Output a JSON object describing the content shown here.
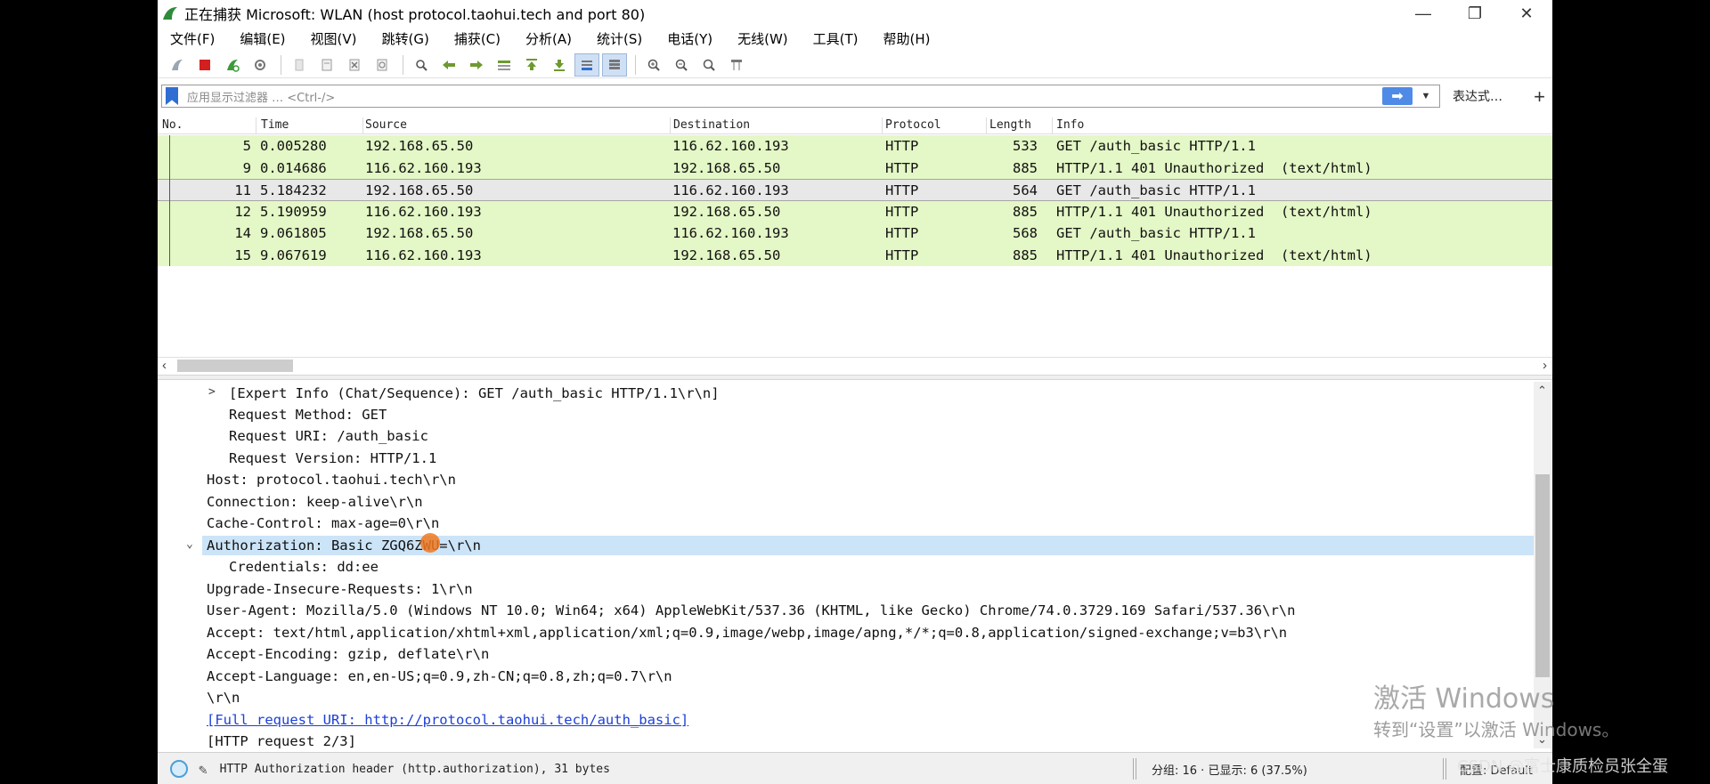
{
  "window": {
    "title": "正在捕获 Microsoft: WLAN (host protocol.taohui.tech and port 80)",
    "buttons": [
      "—",
      "❐",
      "✕"
    ]
  },
  "menu": [
    "文件(F)",
    "编辑(E)",
    "视图(V)",
    "跳转(G)",
    "捕获(C)",
    "分析(A)",
    "统计(S)",
    "电话(Y)",
    "无线(W)",
    "工具(T)",
    "帮助(H)"
  ],
  "filter": {
    "placeholder": "应用显示过滤器 … <Ctrl-/>",
    "apply_glyph": "➡",
    "dropdown_glyph": "▼",
    "expression_label": "表达式…",
    "add_glyph": "+"
  },
  "packet_list": {
    "columns": [
      "No.",
      "Time",
      "Source",
      "Destination",
      "Protocol",
      "Length",
      "Info"
    ],
    "rows": [
      {
        "no": "5",
        "time": "0.005280",
        "source": "192.168.65.50",
        "destination": "116.62.160.193",
        "protocol": "HTTP",
        "length": "533",
        "info": "GET /auth_basic HTTP/1.1"
      },
      {
        "no": "9",
        "time": "0.014686",
        "source": "116.62.160.193",
        "destination": "192.168.65.50",
        "protocol": "HTTP",
        "length": "885",
        "info": "HTTP/1.1 401 Unauthorized  (text/html)"
      },
      {
        "no": "11",
        "time": "5.184232",
        "source": "192.168.65.50",
        "destination": "116.62.160.193",
        "protocol": "HTTP",
        "length": "564",
        "info": "GET /auth_basic HTTP/1.1"
      },
      {
        "no": "12",
        "time": "5.190959",
        "source": "116.62.160.193",
        "destination": "192.168.65.50",
        "protocol": "HTTP",
        "length": "885",
        "info": "HTTP/1.1 401 Unauthorized  (text/html)"
      },
      {
        "no": "14",
        "time": "9.061805",
        "source": "192.168.65.50",
        "destination": "116.62.160.193",
        "protocol": "HTTP",
        "length": "568",
        "info": "GET /auth_basic HTTP/1.1"
      },
      {
        "no": "15",
        "time": "9.067619",
        "source": "116.62.160.193",
        "destination": "192.168.65.50",
        "protocol": "HTTP",
        "length": "885",
        "info": "HTTP/1.1 401 Unauthorized  (text/html)"
      }
    ]
  },
  "details": {
    "lines": [
      "[Expert Info (Chat/Sequence): GET /auth_basic HTTP/1.1\\r\\n]",
      "Request Method: GET",
      "Request URI: /auth_basic",
      "Request Version: HTTP/1.1",
      "Host: protocol.taohui.tech\\r\\n",
      "Connection: keep-alive\\r\\n",
      "Cache-Control: max-age=0\\r\\n",
      "Authorization: Basic ZGQ6ZWU=\\r\\n",
      "Credentials: dd:ee",
      "Upgrade-Insecure-Requests: 1\\r\\n",
      "User-Agent: Mozilla/5.0 (Windows NT 10.0; Win64; x64) AppleWebKit/537.36 (KHTML, like Gecko) Chrome/74.0.3729.169 Safari/537.36\\r\\n",
      "Accept: text/html,application/xhtml+xml,application/xml;q=0.9,image/webp,image/apng,*/*;q=0.8,application/signed-exchange;v=b3\\r\\n",
      "Accept-Encoding: gzip, deflate\\r\\n",
      "Accept-Language: en,en-US;q=0.9,zh-CN;q=0.8,zh;q=0.7\\r\\n",
      "\\r\\n",
      "[Full request URI: http://protocol.taohui.tech/auth_basic]",
      "[HTTP request 2/3]"
    ]
  },
  "status": {
    "field_text": "HTTP Authorization header (http.authorization), 31 bytes",
    "stats": "分组: 16 · 已显示: 6 (37.5%)",
    "profile": "配置: Default"
  },
  "watermark": {
    "line1": "激活 Windows",
    "line2": "转到“设置”以激活 Windows。"
  },
  "csdn": "CSDN @富士康质检员张全蛋",
  "colors": {
    "http_row": "#e4f7c6",
    "selected_row": "#e8e8e8",
    "highlight": "#cce4f7",
    "link": "#1c3fd6"
  }
}
